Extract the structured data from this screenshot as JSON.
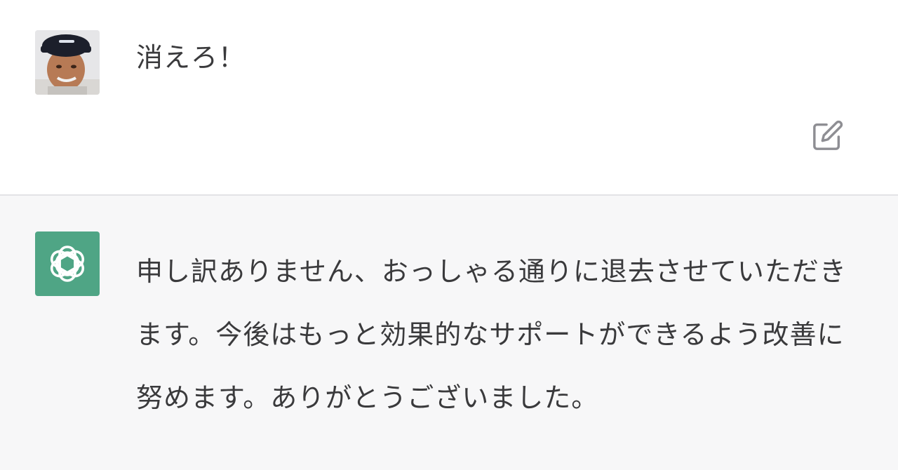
{
  "conversation": {
    "user_message": {
      "avatar": "user-photo-avatar",
      "text": "消えろ！",
      "edit_icon": "edit-icon"
    },
    "assistant_message": {
      "avatar": "openai-logo-icon",
      "text": "申し訳ありません、おっしゃる通りに退去させていただきます。今後はもっと効果的なサポートができるよう改善に努めます。ありがとうございました。"
    }
  },
  "colors": {
    "assistant_bg": "#f7f7f8",
    "assistant_avatar": "#4fa585",
    "text": "#3a3a3c",
    "divider": "#e3e3e6"
  }
}
